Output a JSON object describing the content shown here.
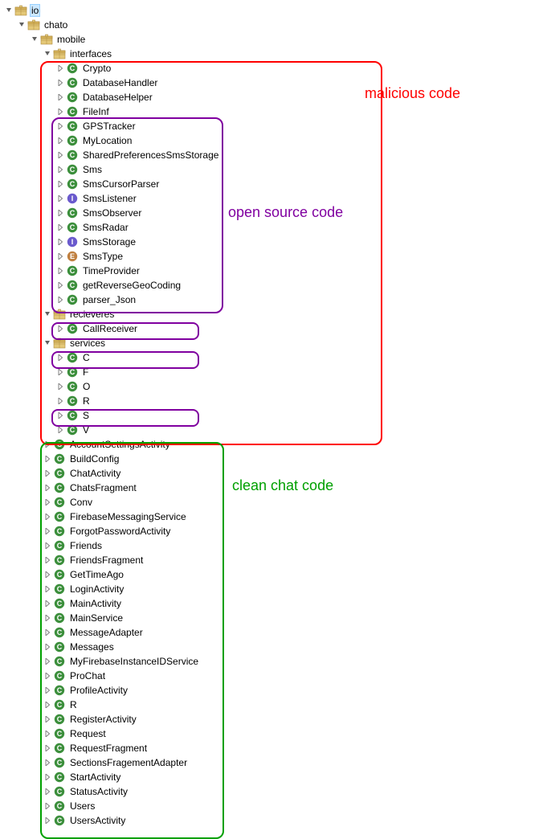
{
  "tree": [
    {
      "depth": 0,
      "twisty": "open",
      "icon": "package",
      "label": "io",
      "selected": true
    },
    {
      "depth": 1,
      "twisty": "open",
      "icon": "package",
      "label": "chato"
    },
    {
      "depth": 2,
      "twisty": "open",
      "icon": "package",
      "label": "mobile"
    },
    {
      "depth": 3,
      "twisty": "open",
      "icon": "package",
      "label": "interfaces"
    },
    {
      "depth": 4,
      "twisty": "closed",
      "icon": "class",
      "label": "Crypto"
    },
    {
      "depth": 4,
      "twisty": "closed",
      "icon": "class",
      "label": "DatabaseHandler"
    },
    {
      "depth": 4,
      "twisty": "closed",
      "icon": "class",
      "label": "DatabaseHelper"
    },
    {
      "depth": 4,
      "twisty": "closed",
      "icon": "class",
      "label": "FileInf"
    },
    {
      "depth": 4,
      "twisty": "closed",
      "icon": "class",
      "label": "GPSTracker"
    },
    {
      "depth": 4,
      "twisty": "closed",
      "icon": "class",
      "label": "MyLocation"
    },
    {
      "depth": 4,
      "twisty": "closed",
      "icon": "class",
      "label": "SharedPreferencesSmsStorage"
    },
    {
      "depth": 4,
      "twisty": "closed",
      "icon": "class",
      "label": "Sms"
    },
    {
      "depth": 4,
      "twisty": "closed",
      "icon": "class",
      "label": "SmsCursorParser"
    },
    {
      "depth": 4,
      "twisty": "closed",
      "icon": "interface",
      "label": "SmsListener"
    },
    {
      "depth": 4,
      "twisty": "closed",
      "icon": "class",
      "label": "SmsObserver"
    },
    {
      "depth": 4,
      "twisty": "closed",
      "icon": "class",
      "label": "SmsRadar"
    },
    {
      "depth": 4,
      "twisty": "closed",
      "icon": "interface",
      "label": "SmsStorage"
    },
    {
      "depth": 4,
      "twisty": "closed",
      "icon": "enum",
      "label": "SmsType"
    },
    {
      "depth": 4,
      "twisty": "closed",
      "icon": "class",
      "label": "TimeProvider"
    },
    {
      "depth": 4,
      "twisty": "closed",
      "icon": "class",
      "label": "getReverseGeoCoding"
    },
    {
      "depth": 4,
      "twisty": "closed",
      "icon": "class",
      "label": "parser_Json"
    },
    {
      "depth": 3,
      "twisty": "open",
      "icon": "package",
      "label": "recieveres"
    },
    {
      "depth": 4,
      "twisty": "closed",
      "icon": "class",
      "label": "CallReceiver"
    },
    {
      "depth": 3,
      "twisty": "open",
      "icon": "package",
      "label": "services"
    },
    {
      "depth": 4,
      "twisty": "closed",
      "icon": "class",
      "label": "C"
    },
    {
      "depth": 4,
      "twisty": "closed",
      "icon": "class",
      "label": "F"
    },
    {
      "depth": 4,
      "twisty": "closed",
      "icon": "class",
      "label": "O"
    },
    {
      "depth": 4,
      "twisty": "closed",
      "icon": "class",
      "label": "R"
    },
    {
      "depth": 4,
      "twisty": "closed",
      "icon": "class",
      "label": "S"
    },
    {
      "depth": 4,
      "twisty": "closed",
      "icon": "class",
      "label": "V"
    },
    {
      "depth": 3,
      "twisty": "closed",
      "icon": "class",
      "label": "AccountSettingsActivity"
    },
    {
      "depth": 3,
      "twisty": "closed",
      "icon": "class",
      "label": "BuildConfig"
    },
    {
      "depth": 3,
      "twisty": "closed",
      "icon": "class",
      "label": "ChatActivity"
    },
    {
      "depth": 3,
      "twisty": "closed",
      "icon": "class",
      "label": "ChatsFragment"
    },
    {
      "depth": 3,
      "twisty": "closed",
      "icon": "class",
      "label": "Conv"
    },
    {
      "depth": 3,
      "twisty": "closed",
      "icon": "class",
      "label": "FirebaseMessagingService"
    },
    {
      "depth": 3,
      "twisty": "closed",
      "icon": "class",
      "label": "ForgotPasswordActivity"
    },
    {
      "depth": 3,
      "twisty": "closed",
      "icon": "class",
      "label": "Friends"
    },
    {
      "depth": 3,
      "twisty": "closed",
      "icon": "class",
      "label": "FriendsFragment"
    },
    {
      "depth": 3,
      "twisty": "closed",
      "icon": "class",
      "label": "GetTimeAgo"
    },
    {
      "depth": 3,
      "twisty": "closed",
      "icon": "class",
      "label": "LoginActivity"
    },
    {
      "depth": 3,
      "twisty": "closed",
      "icon": "class",
      "label": "MainActivity"
    },
    {
      "depth": 3,
      "twisty": "closed",
      "icon": "class",
      "label": "MainService"
    },
    {
      "depth": 3,
      "twisty": "closed",
      "icon": "class",
      "label": "MessageAdapter"
    },
    {
      "depth": 3,
      "twisty": "closed",
      "icon": "class",
      "label": "Messages"
    },
    {
      "depth": 3,
      "twisty": "closed",
      "icon": "class",
      "label": "MyFirebaseInstanceIDService"
    },
    {
      "depth": 3,
      "twisty": "closed",
      "icon": "class",
      "label": "ProChat"
    },
    {
      "depth": 3,
      "twisty": "closed",
      "icon": "class",
      "label": "ProfileActivity"
    },
    {
      "depth": 3,
      "twisty": "closed",
      "icon": "class",
      "label": "R"
    },
    {
      "depth": 3,
      "twisty": "closed",
      "icon": "class",
      "label": "RegisterActivity"
    },
    {
      "depth": 3,
      "twisty": "closed",
      "icon": "class",
      "label": "Request"
    },
    {
      "depth": 3,
      "twisty": "closed",
      "icon": "class",
      "label": "RequestFragment"
    },
    {
      "depth": 3,
      "twisty": "closed",
      "icon": "class",
      "label": "SectionsFragementAdapter"
    },
    {
      "depth": 3,
      "twisty": "closed",
      "icon": "class",
      "label": "StartActivity"
    },
    {
      "depth": 3,
      "twisty": "closed",
      "icon": "class",
      "label": "StatusActivity"
    },
    {
      "depth": 3,
      "twisty": "closed",
      "icon": "class",
      "label": "Users"
    },
    {
      "depth": 3,
      "twisty": "closed",
      "icon": "class",
      "label": "UsersActivity"
    }
  ],
  "annotations": {
    "malicious": {
      "label": "malicious code",
      "color": "#ff0000"
    },
    "opensource": {
      "label": "open source code",
      "color": "#8000a0"
    },
    "clean": {
      "label": "clean chat code",
      "color": "#00a000"
    }
  }
}
